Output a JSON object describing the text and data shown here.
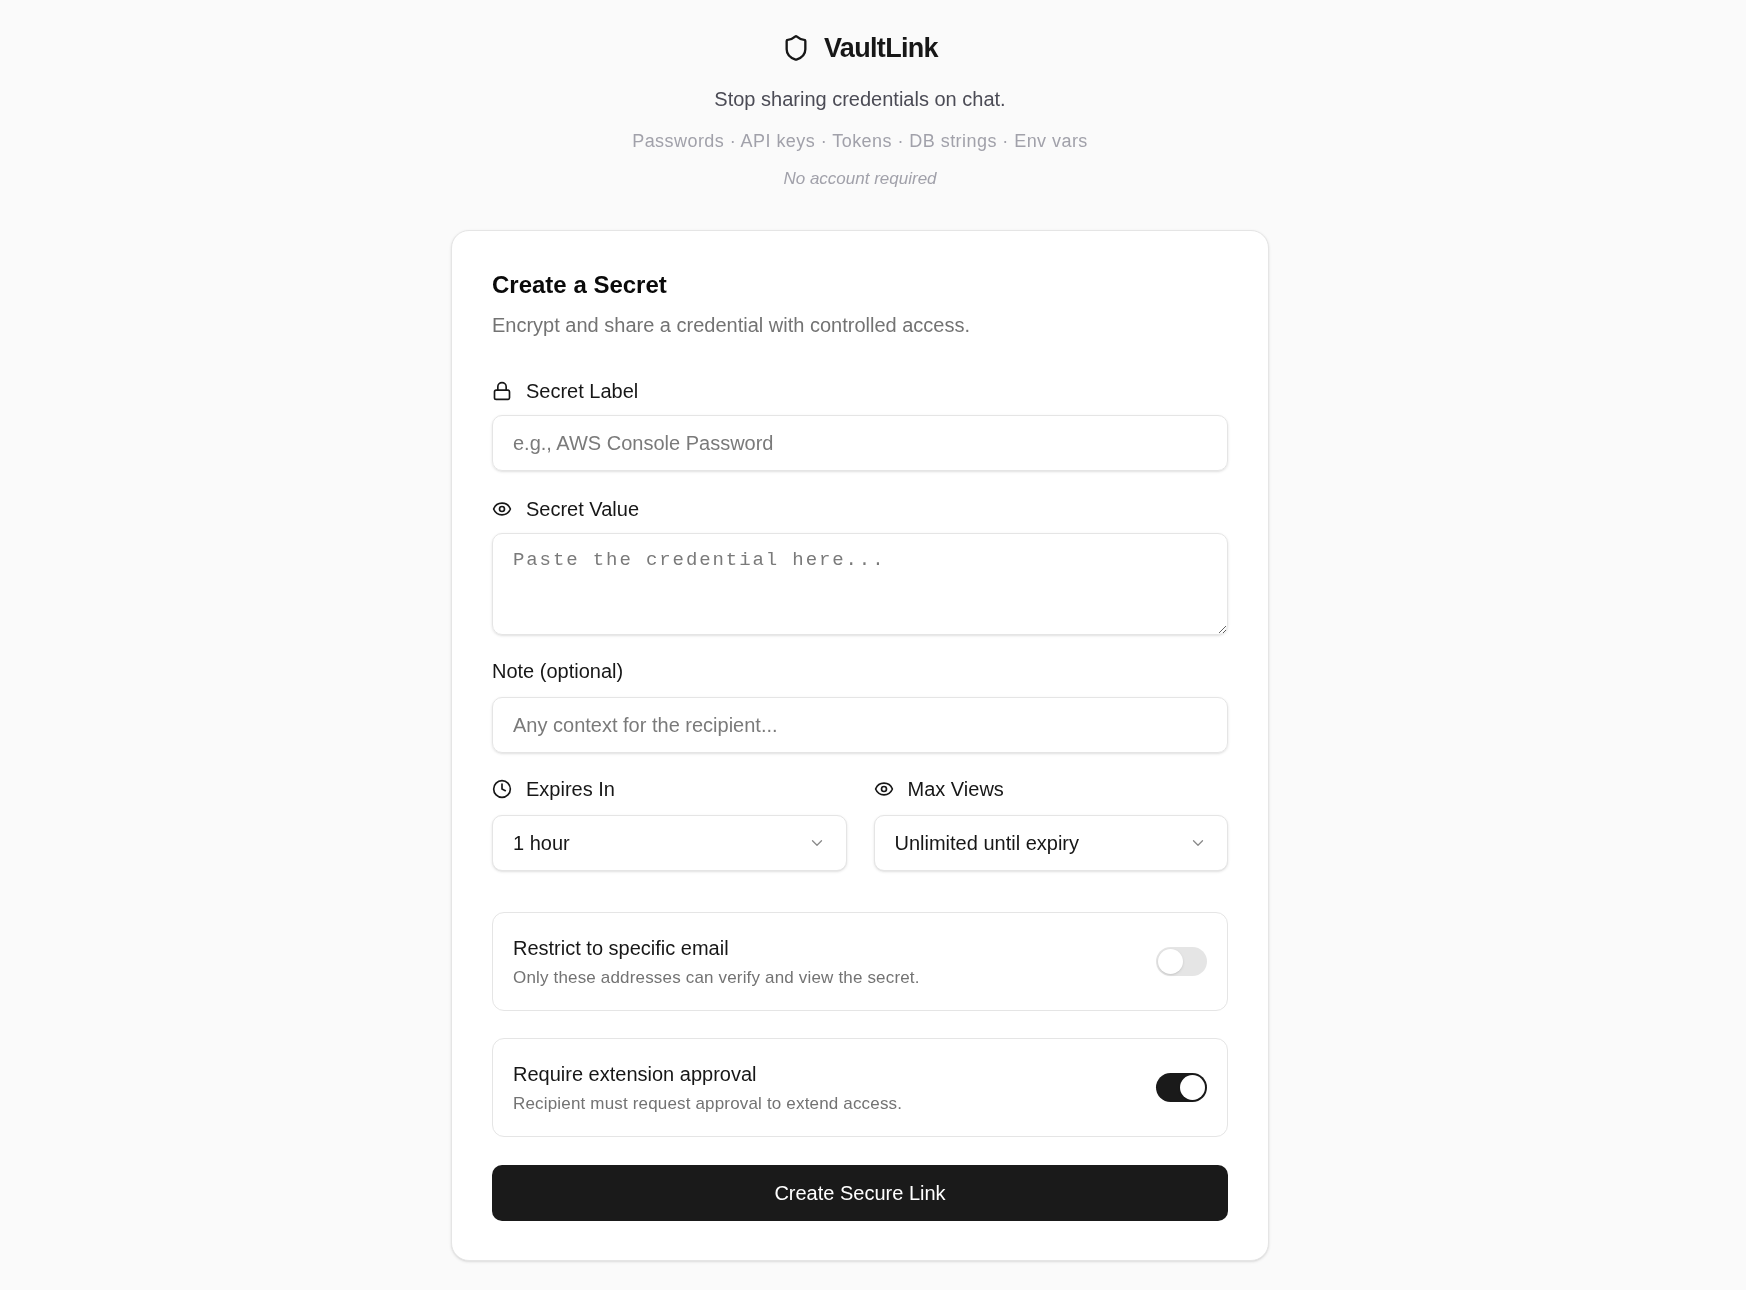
{
  "header": {
    "title": "VaultLink",
    "tagline": "Stop sharing credentials on chat.",
    "types": "Passwords · API keys · Tokens · DB strings · Env vars",
    "note": "No account required"
  },
  "form": {
    "title": "Create a Secret",
    "subtitle": "Encrypt and share a credential with controlled access.",
    "secret_label": {
      "label": "Secret Label",
      "placeholder": "e.g., AWS Console Password"
    },
    "secret_value": {
      "label": "Secret Value",
      "placeholder": "Paste the credential here..."
    },
    "note": {
      "label": "Note (optional)",
      "placeholder": "Any context for the recipient..."
    },
    "expires_in": {
      "label": "Expires In",
      "value": "1 hour"
    },
    "max_views": {
      "label": "Max Views",
      "value": "Unlimited until expiry"
    },
    "toggles": [
      {
        "title": "Restrict to specific email",
        "description": "Only these addresses can verify and view the secret.",
        "on": false
      },
      {
        "title": "Require extension approval",
        "description": "Recipient must request approval to extend access.",
        "on": true
      }
    ],
    "submit": {
      "label": "Create Secure Link"
    }
  }
}
